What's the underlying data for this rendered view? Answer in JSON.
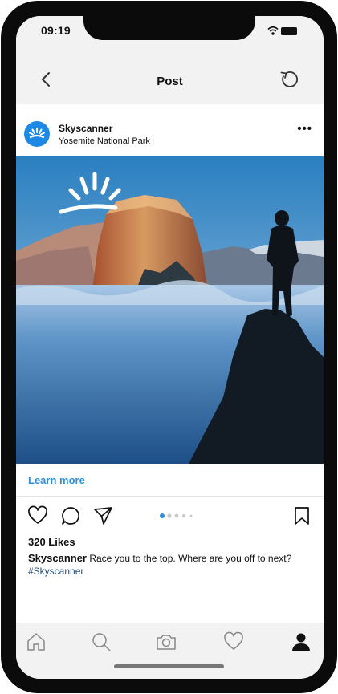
{
  "status_bar": {
    "time": "09:19"
  },
  "nav": {
    "title": "Post",
    "back_icon": "back-chevron-icon",
    "refresh_icon": "refresh-icon"
  },
  "post": {
    "account": "Skyscanner",
    "location": "Yosemite National Park",
    "more_label": "•••",
    "cta": "Learn more",
    "likes": "320 Likes",
    "caption_user": "Skyscanner",
    "caption_text": " Race you to the top. Where are you off to next?",
    "hashtag": "#Skyscanner",
    "carousel": {
      "total": 5,
      "active_index": 1
    }
  },
  "colors": {
    "brand": "#1e88e5",
    "link": "#2d8fd5",
    "hashtag": "#2a4f7c",
    "bar_bg": "#f2f2f2"
  },
  "tab_bar": {
    "items": [
      "home",
      "search",
      "camera",
      "activity",
      "profile"
    ],
    "active": "profile"
  }
}
